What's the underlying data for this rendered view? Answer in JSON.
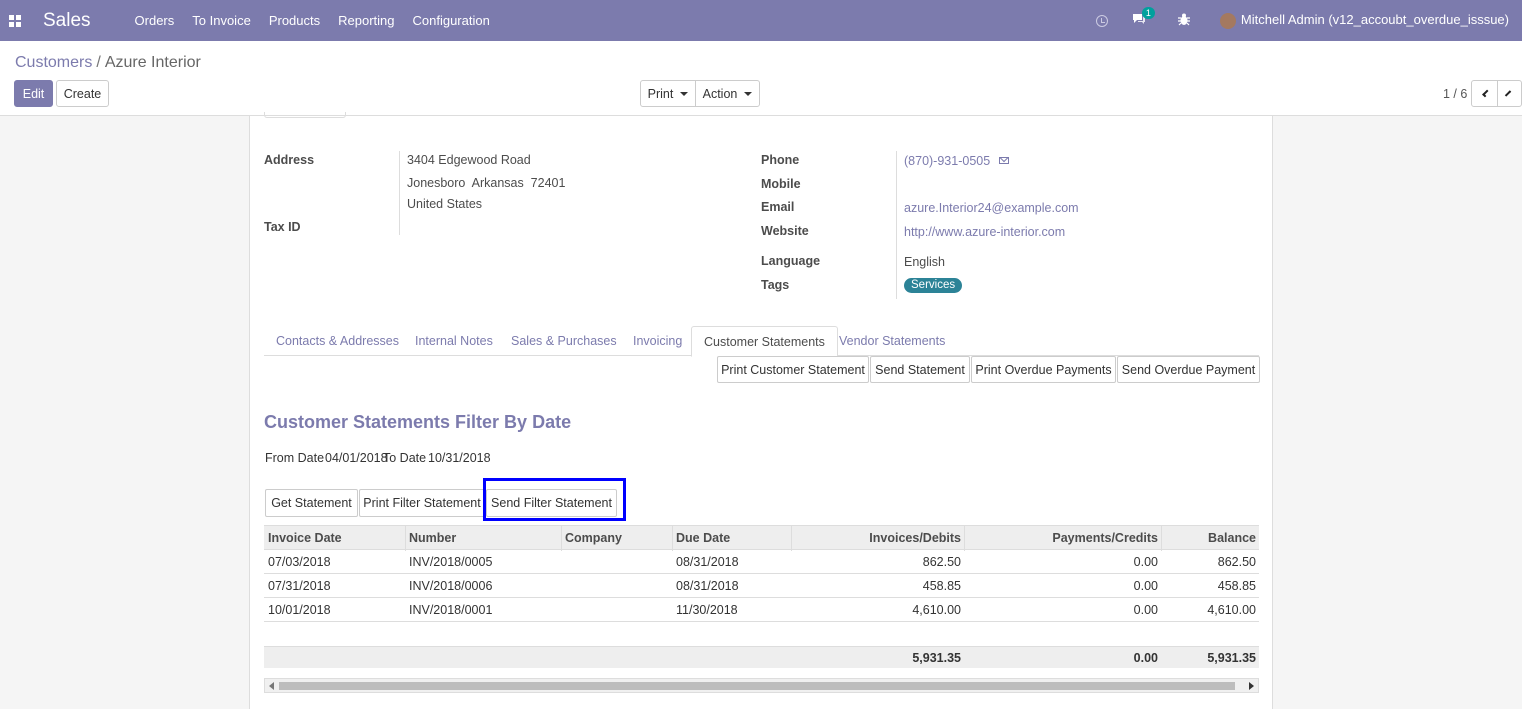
{
  "navbar": {
    "app_name": "Sales",
    "menu": [
      "Orders",
      "To Invoice",
      "Products",
      "Reporting",
      "Configuration"
    ],
    "messages_count": "1",
    "user": "Mitchell Admin (v12_accoubt_overdue_isssue)"
  },
  "control_panel": {
    "breadcrumb_parent": "Customers",
    "breadcrumb_separator": "/",
    "breadcrumb_current": "Azure Interior",
    "edit_label": "Edit",
    "create_label": "Create",
    "print_label": "Print",
    "action_label": "Action",
    "pager": "1 / 6"
  },
  "partner": {
    "address_label": "Address",
    "street": "3404 Edgewood Road",
    "city_line": "Jonesboro  Arkansas  72401",
    "country": "United States",
    "tax_id_label": "Tax ID",
    "phone_label": "Phone",
    "phone": "(870)-931-0505",
    "mobile_label": "Mobile",
    "email_label": "Email",
    "email": "azure.Interior24@example.com",
    "website_label": "Website",
    "website": "http://www.azure-interior.com",
    "language_label": "Language",
    "language": "English",
    "tags_label": "Tags",
    "tag": "Services",
    "tag_color": "#2c8397"
  },
  "tabs": [
    "Contacts & Addresses",
    "Internal Notes",
    "Sales & Purchases",
    "Invoicing",
    "Customer Statements",
    "Vendor Statements"
  ],
  "statement_buttons": [
    "Print Customer Statement",
    "Send Statement",
    "Print Overdue Payments",
    "Send Overdue Payment"
  ],
  "filter": {
    "title": "Customer Statements Filter By Date",
    "from_label": "From Date",
    "from_date": "04/01/2018",
    "to_label": "To Date",
    "to_date": "10/31/2018",
    "get_label": "Get Statement",
    "print_label": "Print Filter Statement",
    "send_label": "Send Filter Statement"
  },
  "table": {
    "headers": [
      "Invoice Date",
      "Number",
      "Company",
      "Due Date",
      "Invoices/Debits",
      "Payments/Credits",
      "Balance"
    ],
    "rows": [
      [
        "07/03/2018",
        "INV/2018/0005",
        "",
        "08/31/2018",
        "862.50",
        "0.00",
        "862.50"
      ],
      [
        "07/31/2018",
        "INV/2018/0006",
        "",
        "08/31/2018",
        "458.85",
        "0.00",
        "458.85"
      ],
      [
        "10/01/2018",
        "INV/2018/0001",
        "",
        "11/30/2018",
        "4,610.00",
        "0.00",
        "4,610.00"
      ]
    ],
    "totals": [
      "5,931.35",
      "0.00",
      "5,931.35"
    ]
  },
  "accent_color": "#7c7bad",
  "highlight_color": "#0000ff"
}
